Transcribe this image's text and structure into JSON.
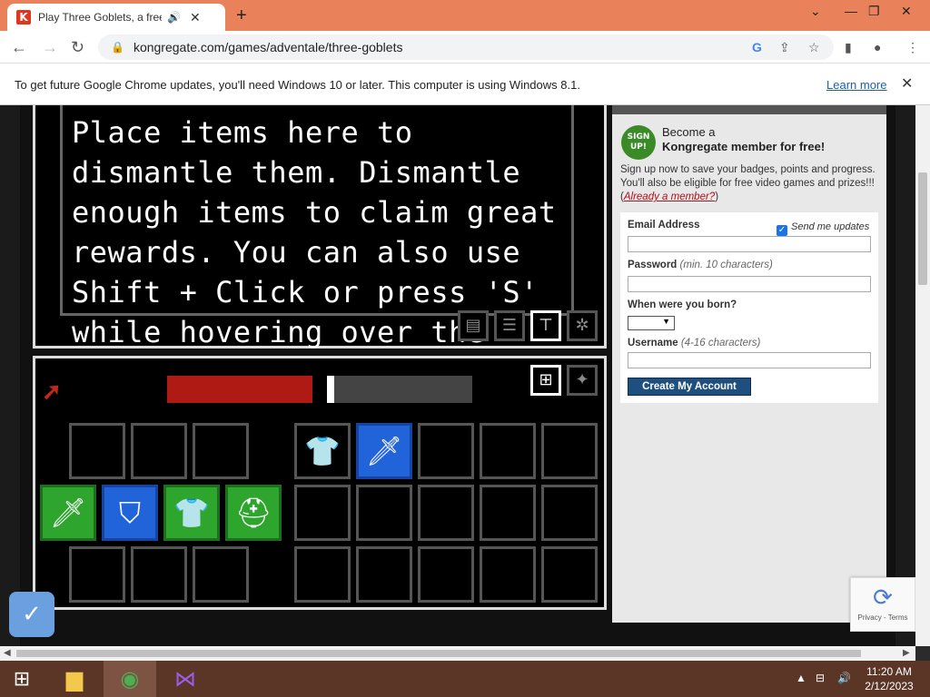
{
  "browser": {
    "tab_title": "Play Three Goblets, a free on",
    "favicon_letter": "K",
    "new_tab": "+",
    "url": "kongregate.com/games/adventale/three-goblets",
    "window_controls": {
      "minimize": "—",
      "restore": "❐",
      "close": "✕",
      "tab_list": "⌄"
    }
  },
  "infobar": {
    "message": "To get future Google Chrome updates, you'll need Windows 10 or later. This computer is using Windows 8.1.",
    "learn_more": "Learn more"
  },
  "game": {
    "tooltip_text": "Place items here to dismantle them. Dismantle enough items to claim great rewards. You can also use Shift + Click or press 'S' while hovering over the item.",
    "progress_fraction": 0.5,
    "tab_icons": [
      "list-icon",
      "menu-icon",
      "anvil-icon",
      "gear-icon"
    ],
    "inventory_buttons": [
      "grid-icon",
      "star-icon"
    ],
    "slots_row1": [
      {
        "state": "empty"
      },
      {
        "state": "empty"
      },
      {
        "state": "empty"
      },
      {
        "state": "filled",
        "icon": "shirt-icon",
        "glyph": "👕"
      },
      {
        "state": "blue",
        "icon": "sword-icon",
        "glyph": "🗡"
      },
      {
        "state": "empty"
      },
      {
        "state": "empty"
      },
      {
        "state": "empty"
      }
    ],
    "slots_row2": [
      {
        "state": "green",
        "icon": "sword-icon",
        "glyph": "🗡"
      },
      {
        "state": "blue",
        "icon": "shield-icon",
        "glyph": "⛉"
      },
      {
        "state": "green",
        "icon": "shirt-icon",
        "glyph": "👕"
      },
      {
        "state": "green",
        "icon": "helmet-icon",
        "glyph": "⛑"
      },
      {
        "state": "empty"
      },
      {
        "state": "empty"
      },
      {
        "state": "empty"
      },
      {
        "state": "empty"
      },
      {
        "state": "empty"
      }
    ]
  },
  "signup": {
    "badge": "SIGN UP!",
    "become": "Become a",
    "member": "Kongregate member for free!",
    "desc": "Sign up now to save your badges, points and progress. You'll also be eligible for free video games and prizes!!!",
    "already_member": "Already a member?",
    "email_label": "Email Address",
    "send_updates": "Send me updates",
    "password_label": "Password",
    "password_hint": "(min. 10 characters)",
    "born_label": "When were you born?",
    "username_label": "Username",
    "username_hint": "(4-16 characters)",
    "create_button": "Create My Account"
  },
  "recaptcha": {
    "text": "Privacy - Terms"
  },
  "taskbar": {
    "time": "11:20 AM",
    "date": "2/12/2023"
  }
}
